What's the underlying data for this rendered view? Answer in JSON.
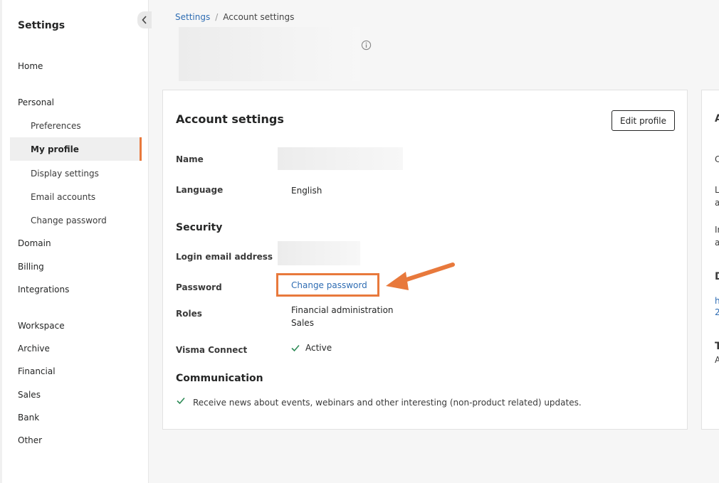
{
  "sidebar": {
    "title": "Settings",
    "items": [
      {
        "label": "Home",
        "key": "home"
      },
      {
        "label": "Personal",
        "key": "personal"
      },
      {
        "label": "Preferences",
        "key": "preferences"
      },
      {
        "label": "My profile",
        "key": "my-profile"
      },
      {
        "label": "Display settings",
        "key": "display-settings"
      },
      {
        "label": "Email accounts",
        "key": "email-accounts"
      },
      {
        "label": "Change password",
        "key": "change-password"
      },
      {
        "label": "Domain",
        "key": "domain"
      },
      {
        "label": "Billing",
        "key": "billing"
      },
      {
        "label": "Integrations",
        "key": "integrations"
      },
      {
        "label": "Workspace",
        "key": "workspace"
      },
      {
        "label": "Archive",
        "key": "archive"
      },
      {
        "label": "Financial",
        "key": "financial"
      },
      {
        "label": "Sales",
        "key": "sales"
      },
      {
        "label": "Bank",
        "key": "bank"
      },
      {
        "label": "Other",
        "key": "other"
      }
    ]
  },
  "breadcrumb": {
    "parent": "Settings",
    "separator": "/",
    "current": "Account settings"
  },
  "card": {
    "title": "Account settings",
    "edit_button": "Edit profile",
    "fields": {
      "name_label": "Name",
      "language_label": "Language",
      "language_value": "English",
      "security_title": "Security",
      "login_email_label": "Login email address",
      "password_label": "Password",
      "change_password_link": "Change password",
      "roles_label": "Roles",
      "roles": [
        "Financial administration",
        "Sales"
      ],
      "visma_connect_label": "Visma Connect",
      "visma_connect_status": "Active",
      "communication_title": "Communication",
      "communication_text": "Receive news about events, webinars and other interesting (non-product related) updates."
    }
  },
  "right_card": {
    "fragments": [
      "A",
      "C",
      "L",
      "a",
      "Ir",
      "a",
      "D",
      "h",
      "2",
      "T",
      "A"
    ]
  },
  "colors": {
    "accent_orange": "#e8793c",
    "link_blue": "#2f6db3",
    "check_green": "#2e8b57"
  },
  "icons": {
    "collapse": "chevron-left-icon",
    "info": "info-icon",
    "check": "check-icon",
    "annotation": "arrow-icon"
  }
}
